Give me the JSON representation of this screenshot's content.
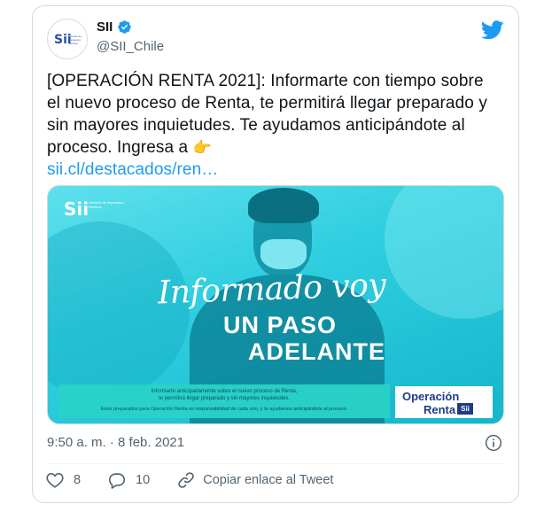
{
  "tweet": {
    "author": {
      "display_name": "SII",
      "handle": "@SII_Chile",
      "avatar_logo_text": "Sii",
      "avatar_logo_subtext": "Servicio de Impuestos Internos",
      "verified": true
    },
    "text_main": "[OPERACIÓN RENTA 2021]: Informarte con tiempo sobre el nuevo proceso de Renta, te permitirá llegar preparado y sin mayores inquietudes. Te ayudamos anticipándote al proceso. Ingresa a ",
    "text_emoji": "👉",
    "link_text": "sii.cl/destacados/ren…",
    "timestamp": "9:50 a. m. · 8 feb. 2021",
    "actions": {
      "likes": "8",
      "replies": "10",
      "copy_link_label": "Copiar enlace al Tweet"
    }
  },
  "media": {
    "logo_text": "Sii",
    "logo_subtext": "Servicio de Impuestos Internos",
    "headline_script": "Informado voy",
    "headline_line2": "UN PASO",
    "headline_line3": "ADELANTE",
    "info_line1": "Informarte anticipadamente sobre el nuevo proceso de Renta,",
    "info_line2": "te permitirá llegar preparado y sin mayores inquietudes.",
    "info_line3": "Estar preparados para Operación Renta es responsabilidad de cada uno, y te ayudamos anticipándote al proceso.",
    "operacion_line1": "Operación",
    "operacion_line2": "Renta",
    "operacion_badge": "Sii"
  },
  "colors": {
    "link": "#1d9bf0",
    "twitter_blue": "#1d9bf0",
    "text_secondary": "#536471",
    "media_cyan": "#31cfe0"
  },
  "icons": [
    "verified-icon",
    "twitter-bird-icon",
    "info-icon",
    "heart-icon",
    "reply-icon",
    "link-icon"
  ]
}
